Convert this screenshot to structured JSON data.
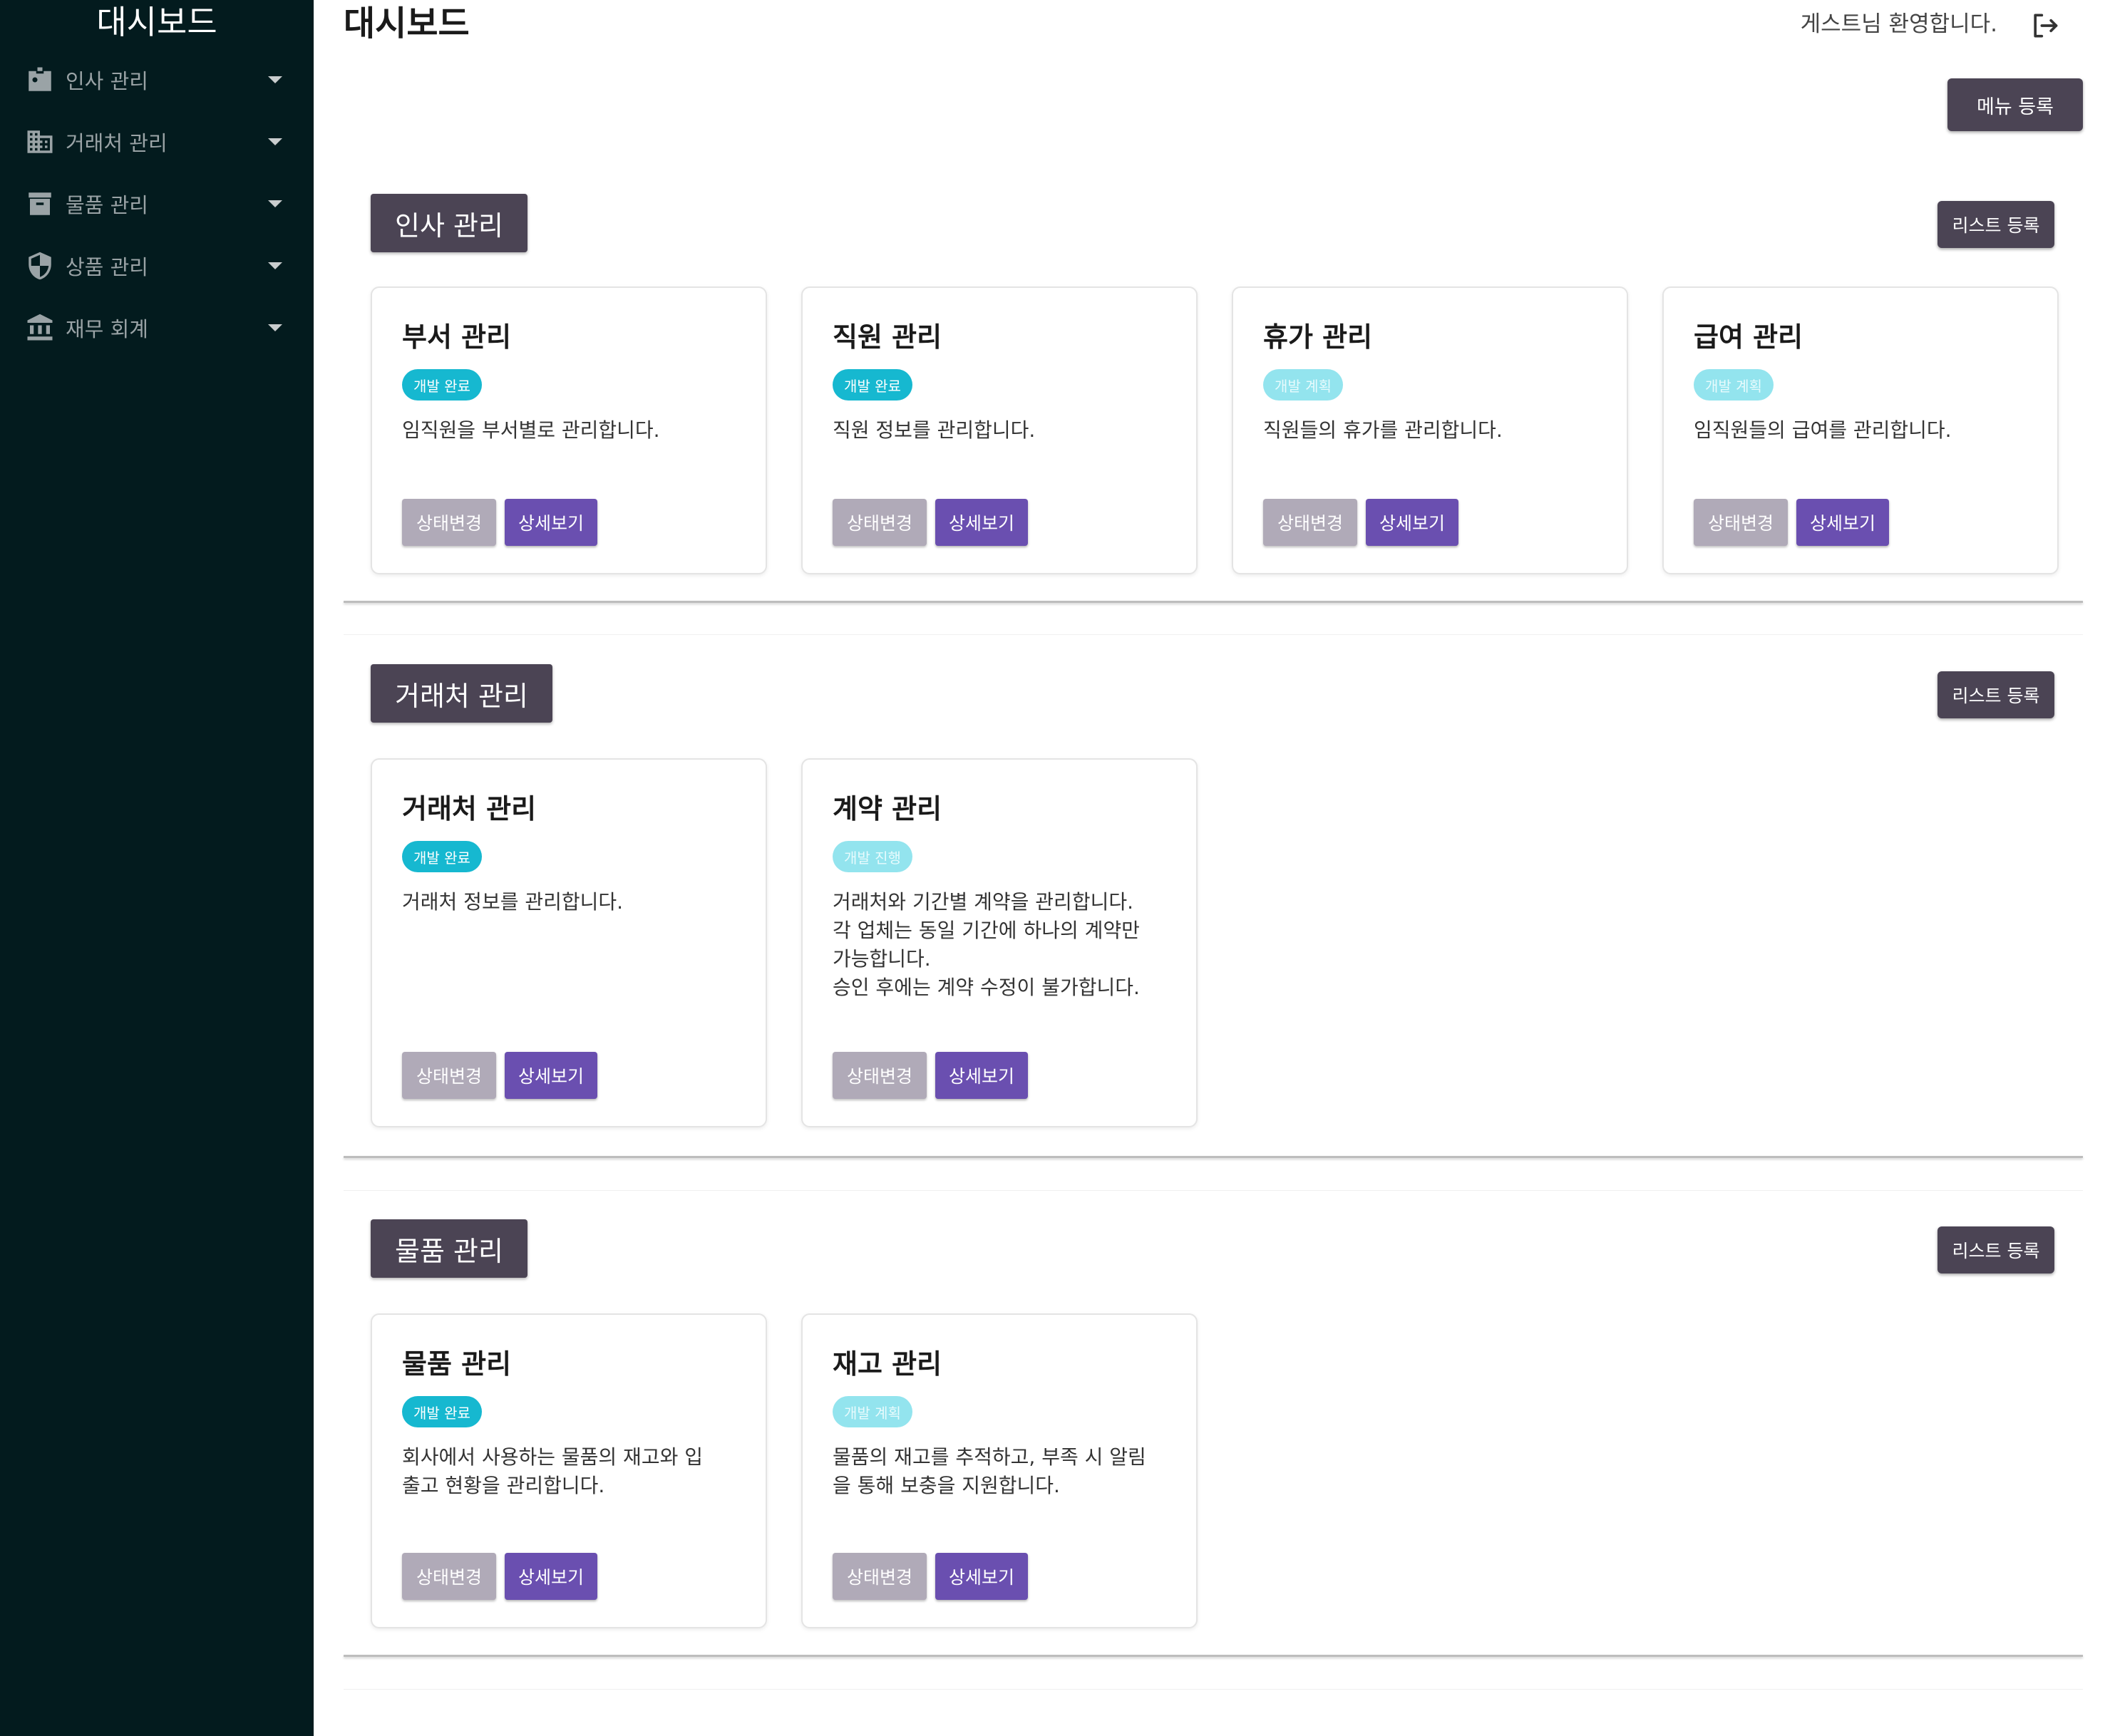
{
  "sidebar": {
    "title": "대시보드",
    "items": [
      {
        "label": "인사 관리",
        "icon": "id-badge-icon"
      },
      {
        "label": "거래처 관리",
        "icon": "building-icon"
      },
      {
        "label": "물품 관리",
        "icon": "archive-box-icon"
      },
      {
        "label": "상품 관리",
        "icon": "shield-icon"
      },
      {
        "label": "재무 회계",
        "icon": "bank-icon"
      }
    ]
  },
  "header": {
    "title": "대시보드",
    "welcome": "게스트님 환영합니다.",
    "menu_register": "메뉴 등록"
  },
  "colors": {
    "sidebar_bg": "#031b1e",
    "chip_bg": "#4b4454",
    "badge_done": "#16b8d0",
    "badge_plan": "#93e4ee",
    "detail_button": "#6a4fb0",
    "status_button": "#b0aab8"
  },
  "sections": [
    {
      "title": "인사 관리",
      "list_register": "리스트 등록",
      "cards": [
        {
          "title": "부서 관리",
          "badge": "개발 완료",
          "badge_state": "done",
          "desc": "임직원을 부서별로 관리합니다.",
          "status_btn": "상태변경",
          "detail_btn": "상세보기"
        },
        {
          "title": "직원 관리",
          "badge": "개발 완료",
          "badge_state": "done",
          "desc": "직원 정보를 관리합니다.",
          "status_btn": "상태변경",
          "detail_btn": "상세보기"
        },
        {
          "title": "휴가 관리",
          "badge": "개발 계획",
          "badge_state": "plan",
          "desc": "직원들의 휴가를 관리합니다.",
          "status_btn": "상태변경",
          "detail_btn": "상세보기"
        },
        {
          "title": "급여 관리",
          "badge": "개발 계획",
          "badge_state": "plan",
          "desc": "임직원들의 급여를 관리합니다.",
          "status_btn": "상태변경",
          "detail_btn": "상세보기"
        }
      ]
    },
    {
      "title": "거래처 관리",
      "list_register": "리스트 등록",
      "cards": [
        {
          "title": "거래처 관리",
          "badge": "개발 완료",
          "badge_state": "done",
          "desc": "거래처 정보를 관리합니다.",
          "status_btn": "상태변경",
          "detail_btn": "상세보기"
        },
        {
          "title": "계약 관리",
          "badge": "개발 진행",
          "badge_state": "plan",
          "desc": "거래처와 기간별 계약을 관리합니다.\n각 업체는 동일 기간에 하나의 계약만\n가능합니다.\n승인 후에는 계약 수정이 불가합니다.",
          "status_btn": "상태변경",
          "detail_btn": "상세보기"
        }
      ]
    },
    {
      "title": "물품 관리",
      "list_register": "리스트 등록",
      "cards": [
        {
          "title": "물품 관리",
          "badge": "개발 완료",
          "badge_state": "done",
          "desc": "회사에서 사용하는 물품의 재고와 입\n출고 현황을 관리합니다.",
          "status_btn": "상태변경",
          "detail_btn": "상세보기"
        },
        {
          "title": "재고 관리",
          "badge": "개발 계획",
          "badge_state": "plan",
          "desc": "물품의 재고를 추적하고, 부족 시 알림\n을 통해 보충을 지원합니다.",
          "status_btn": "상태변경",
          "detail_btn": "상세보기"
        }
      ]
    }
  ]
}
